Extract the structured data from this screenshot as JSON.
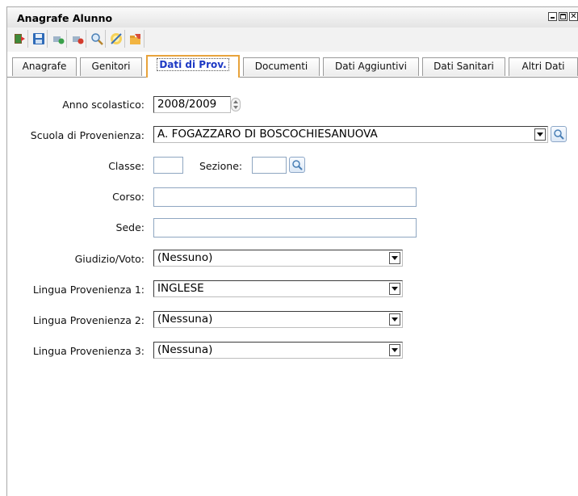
{
  "window": {
    "title": "Anagrafe Alunno"
  },
  "toolbar": {
    "buttons": [
      {
        "name": "exit-icon"
      },
      {
        "name": "save-icon"
      },
      {
        "name": "new-record-icon"
      },
      {
        "name": "delete-record-icon"
      },
      {
        "name": "search-icon"
      },
      {
        "name": "edit-icon"
      },
      {
        "name": "open-folder-icon"
      }
    ]
  },
  "tabs": [
    {
      "label": "Anagrafe"
    },
    {
      "label": "Genitori"
    },
    {
      "label": "Dati di Prov."
    },
    {
      "label": "Documenti"
    },
    {
      "label": "Dati Aggiuntivi"
    },
    {
      "label": "Dati Sanitari"
    },
    {
      "label": "Altri Dati"
    }
  ],
  "form": {
    "anno_label": "Anno scolastico:",
    "anno_value": "2008/2009",
    "scuola_label": "Scuola di Provenienza:",
    "scuola_value": "A. FOGAZZARO DI BOSCOCHIESANUOVA",
    "classe_label": "Classe:",
    "classe_value": "",
    "sezione_label": "Sezione:",
    "sezione_value": "",
    "corso_label": "Corso:",
    "corso_value": "",
    "sede_label": "Sede:",
    "sede_value": "",
    "giudizio_label": "Giudizio/Voto:",
    "giudizio_value": "(Nessuno)",
    "lingua1_label": "Lingua Provenienza 1:",
    "lingua1_value": "INGLESE",
    "lingua2_label": "Lingua Provenienza 2:",
    "lingua2_value": "(Nessuna)",
    "lingua3_label": "Lingua Provenienza 3:",
    "lingua3_value": "(Nessuna)"
  },
  "colors": {
    "active_tab_border": "#e8a33c",
    "active_tab_text": "#1d39c4",
    "field_border": "#8fa6c1"
  }
}
